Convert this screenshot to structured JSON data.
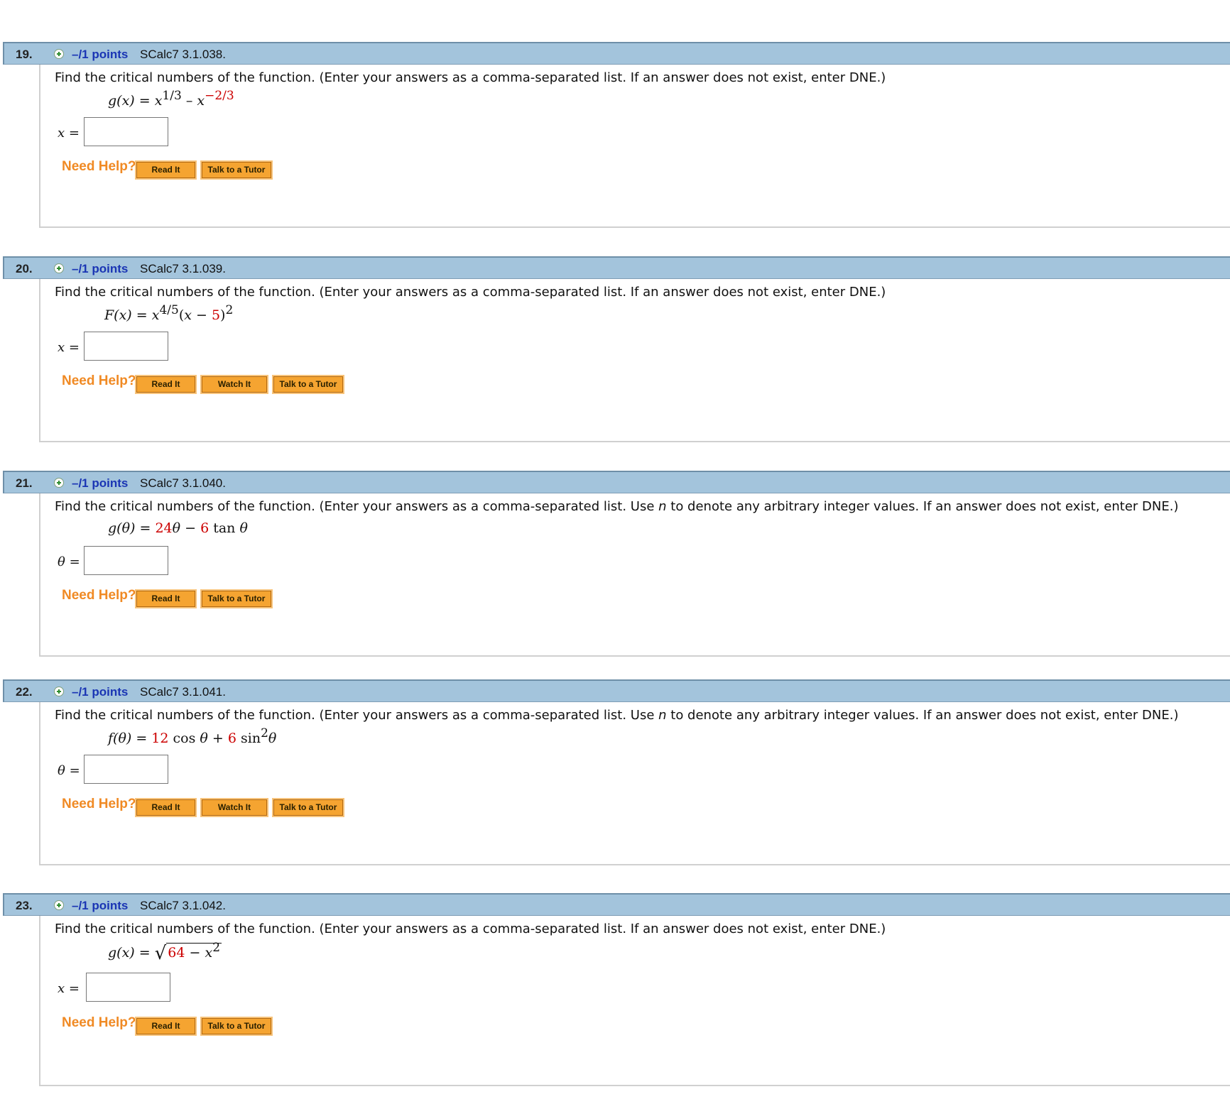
{
  "need_help_label": "Need Help?",
  "buttons": {
    "read_it": "Read It",
    "watch_it": "Watch It",
    "talk_to_tutor": "Talk to a Tutor"
  },
  "questions": [
    {
      "number": "19.",
      "points": "–/1 points",
      "code": "SCalc7 3.1.038.",
      "prompt": "Find the critical numbers of the function. (Enter your answers as a comma-separated list. If an answer does not exist, enter DNE.)",
      "formula": {
        "lhs": "g(x)",
        "eq": " = ",
        "base1": "x",
        "exp1": "1/3",
        "op": " – ",
        "base2": "x",
        "exp2": "−2/3"
      },
      "answer_var": "x",
      "answer_eq": " =",
      "answer_value": ""
    },
    {
      "number": "20.",
      "points": "–/1 points",
      "code": "SCalc7 3.1.039.",
      "prompt": "Find the critical numbers of the function. (Enter your answers as a comma-separated list. If an answer does not exist, enter DNE.)",
      "formula": {
        "lhs": "F(x)",
        "eq": " = ",
        "base1": "x",
        "exp1": "4/5",
        "open": "(",
        "var": "x",
        "minus": " − ",
        "const": "5",
        "close": ")",
        "exp2": "2"
      },
      "answer_var": "x",
      "answer_eq": " =",
      "answer_value": ""
    },
    {
      "number": "21.",
      "points": "–/1 points",
      "code": "SCalc7 3.1.040.",
      "prompt_a": "Find the critical numbers of the function. (Enter your answers as a comma-separated list. Use ",
      "prompt_n": "n",
      "prompt_b": " to denote any arbitrary integer values. If an answer does not exist, enter DNE.)",
      "formula": {
        "lhs": "g(θ)",
        "eq": " = ",
        "c1": "24",
        "v1": "θ",
        "minus": " − ",
        "c2": "6",
        "rest": " tan ",
        "v2": "θ"
      },
      "answer_var": "θ",
      "answer_eq": " =",
      "answer_value": ""
    },
    {
      "number": "22.",
      "points": "–/1 points",
      "code": "SCalc7 3.1.041.",
      "prompt_a": "Find the critical numbers of the function. (Enter your answers as a comma-separated list. Use ",
      "prompt_n": "n",
      "prompt_b": " to denote any arbitrary integer values. If an answer does not exist, enter DNE.)",
      "formula": {
        "lhs": "f(θ)",
        "eq": " = ",
        "c1": "12",
        "t1": " cos ",
        "v1": "θ",
        "plus": " + ",
        "c2": "6",
        "t2": " sin",
        "exp": "2",
        "v2": "θ"
      },
      "answer_var": "θ",
      "answer_eq": " =",
      "answer_value": ""
    },
    {
      "number": "23.",
      "points": "–/1 points",
      "code": "SCalc7 3.1.042.",
      "prompt": "Find the critical numbers of the function. (Enter your answers as a comma-separated list. If an answer does not exist, enter DNE.)",
      "formula": {
        "lhs": "g(x)",
        "eq": " = ",
        "sqrt": "√",
        "c1": "64",
        "minus": " − ",
        "var": "x",
        "exp": "2"
      },
      "answer_var": "x",
      "answer_eq": " =",
      "answer_value": ""
    }
  ]
}
